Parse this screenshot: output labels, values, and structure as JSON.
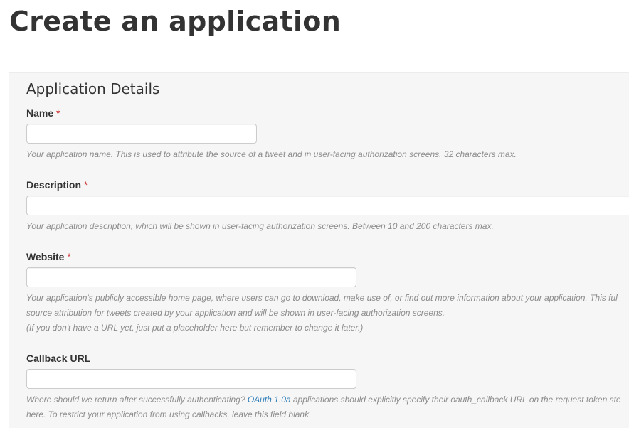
{
  "page": {
    "title": "Create an application"
  },
  "details": {
    "heading": "Application Details",
    "required_mark": "*",
    "name": {
      "label": "Name",
      "value": "",
      "help": "Your application name. This is used to attribute the source of a tweet and in user-facing authorization screens. 32 characters max."
    },
    "description": {
      "label": "Description",
      "value": "",
      "help": "Your application description, which will be shown in user-facing authorization screens. Between 10 and 200 characters max."
    },
    "website": {
      "label": "Website",
      "value": "",
      "help_line1": "Your application's publicly accessible home page, where users can go to download, make use of, or find out more information about your application. This ful",
      "help_line2": "source attribution for tweets created by your application and will be shown in user-facing authorization screens.",
      "help_line3": "(If you don't have a URL yet, just put a placeholder here but remember to change it later.)"
    },
    "callback": {
      "label": "Callback URL",
      "value": "",
      "help_pre": "Where should we return after successfully authenticating? ",
      "help_link": "OAuth 1.0a",
      "help_post": " applications should explicitly specify their oauth_callback URL on the request token ste",
      "help_line2": "here. To restrict your application from using callbacks, leave this field blank."
    }
  }
}
